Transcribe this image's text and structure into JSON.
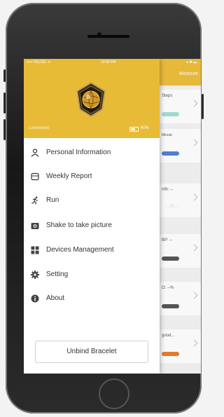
{
  "status_bar": {
    "carrier": "••••• TELCEL ≎",
    "time": "12:00 PM"
  },
  "main": {
    "title": "Measure",
    "cards": [
      {
        "label": "Steps",
        "bar_color": "#9fd9d2"
      },
      {
        "label": "Minute",
        "bar_color": "#4f7fd6"
      },
      {
        "label": "HR: --",
        "bar_color": ""
      },
      {
        "label": "BP: --",
        "bar_color": "#555555"
      },
      {
        "label": "O: --%",
        "bar_color": "#555555"
      },
      {
        "label": "good...",
        "bar_color": "#e07a2e"
      }
    ]
  },
  "drawer": {
    "connected": "Connected",
    "battery": "60%",
    "menu": [
      {
        "label": "Personal Information",
        "icon": "person-icon"
      },
      {
        "label": "Weekly Report",
        "icon": "report-icon"
      },
      {
        "label": "Run",
        "icon": "run-icon"
      },
      {
        "label": "Shake to take picture",
        "icon": "camera-icon"
      },
      {
        "label": "Devices Management",
        "icon": "grid-icon"
      },
      {
        "label": "Setting",
        "icon": "gear-icon"
      },
      {
        "label": "About",
        "icon": "info-icon"
      }
    ],
    "unbind": "Unbind Bracelet"
  },
  "colors": {
    "accent": "#e8bb37"
  }
}
